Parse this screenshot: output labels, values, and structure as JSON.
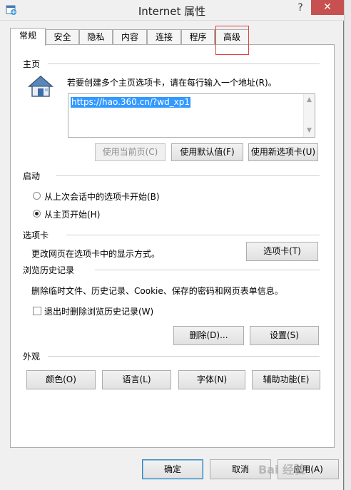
{
  "window": {
    "title": "Internet 属性",
    "help_glyph": "?",
    "close_glyph": "✕"
  },
  "tabs": [
    {
      "label": "常规",
      "active": true
    },
    {
      "label": "安全"
    },
    {
      "label": "隐私"
    },
    {
      "label": "内容"
    },
    {
      "label": "连接"
    },
    {
      "label": "程序"
    },
    {
      "label": "高级"
    }
  ],
  "homepage": {
    "section": "主页",
    "instruction": "若要创建多个主页选项卡，请在每行输入一个地址(R)。",
    "url": "https://hao.360.cn/?wd_xp1",
    "btn_current": "使用当前页(C)",
    "btn_default": "使用默认值(F)",
    "btn_new_tab": "使用新选项卡(U)"
  },
  "startup": {
    "section": "启动",
    "option_last": "从上次会话中的选项卡开始(B)",
    "option_home": "从主页开始(H)"
  },
  "tabs_section": {
    "section": "选项卡",
    "description": "更改网页在选项卡中的显示方式。",
    "button": "选项卡(T)"
  },
  "history": {
    "section": "浏览历史记录",
    "description": "删除临时文件、历史记录、Cookie、保存的密码和网页表单信息。",
    "checkbox": "退出时删除浏览历史记录(W)",
    "btn_delete": "删除(D)...",
    "btn_settings": "设置(S)"
  },
  "appearance": {
    "section": "外观",
    "btn_colors": "颜色(O)",
    "btn_language": "语言(L)",
    "btn_fonts": "字体(N)",
    "btn_accessibility": "辅助功能(E)"
  },
  "footer": {
    "ok": "确定",
    "cancel": "取消",
    "apply": "应用(A)"
  },
  "watermark": "Bai 经验"
}
